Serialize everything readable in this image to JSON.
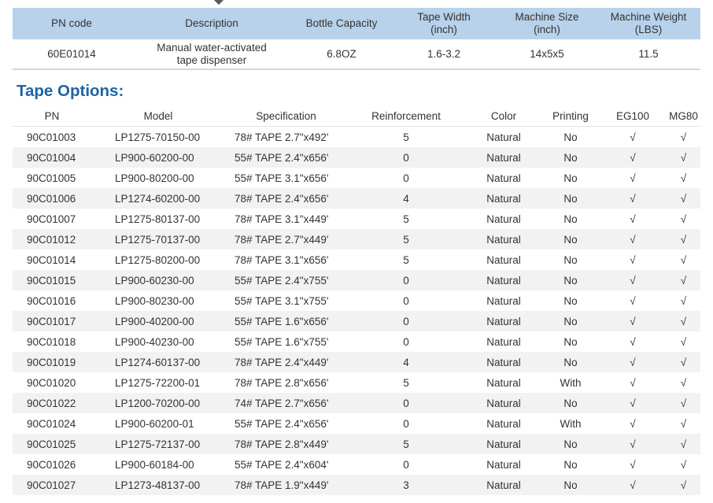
{
  "spec_table": {
    "headers": [
      "PN code",
      "Description",
      "Bottle Capacity",
      "Tape Width\n(inch)",
      "Machine Size\n(inch)",
      "Machine Weight\n(LBS)"
    ],
    "row": [
      "60E01014",
      "Manual water-activated tape dispenser",
      "6.8OZ",
      "1.6-3.2",
      "14x5x5",
      "11.5"
    ]
  },
  "tape_options": {
    "title": "Tape Options:",
    "headers": [
      "PN",
      "Model",
      "Specification",
      "Reinforcement",
      "Color",
      "Printing",
      "EG100",
      "MG80"
    ],
    "rows": [
      [
        "90C01003",
        "LP1275-70150-00",
        "78# TAPE 2.7\"x492'",
        "5",
        "Natural",
        "No",
        "√",
        "√"
      ],
      [
        "90C01004",
        "LP900-60200-00",
        "55# TAPE 2.4\"x656'",
        "0",
        "Natural",
        "No",
        "√",
        "√"
      ],
      [
        "90C01005",
        "LP900-80200-00",
        "55# TAPE 3.1\"x656'",
        "0",
        "Natural",
        "No",
        "√",
        "√"
      ],
      [
        "90C01006",
        "LP1274-60200-00",
        "78# TAPE 2.4\"x656'",
        "4",
        "Natural",
        "No",
        "√",
        "√"
      ],
      [
        "90C01007",
        "LP1275-80137-00",
        "78# TAPE 3.1\"x449'",
        "5",
        "Natural",
        "No",
        "√",
        "√"
      ],
      [
        "90C01012",
        "LP1275-70137-00",
        "78# TAPE 2.7\"x449'",
        "5",
        "Natural",
        "No",
        "√",
        "√"
      ],
      [
        "90C01014",
        "LP1275-80200-00",
        "78# TAPE 3.1\"x656'",
        "5",
        "Natural",
        "No",
        "√",
        "√"
      ],
      [
        "90C01015",
        "LP900-60230-00",
        "55# TAPE 2.4\"x755'",
        "0",
        "Natural",
        "No",
        "√",
        "√"
      ],
      [
        "90C01016",
        "LP900-80230-00",
        "55# TAPE 3.1\"x755'",
        "0",
        "Natural",
        "No",
        "√",
        "√"
      ],
      [
        "90C01017",
        "LP900-40200-00",
        "55# TAPE 1.6\"x656'",
        "0",
        "Natural",
        "No",
        "√",
        "√"
      ],
      [
        "90C01018",
        "LP900-40230-00",
        "55# TAPE 1.6\"x755'",
        "0",
        "Natural",
        "No",
        "√",
        "√"
      ],
      [
        "90C01019",
        "LP1274-60137-00",
        "78# TAPE 2.4\"x449'",
        "4",
        "Natural",
        "No",
        "√",
        "√"
      ],
      [
        "90C01020",
        "LP1275-72200-01",
        "78# TAPE 2.8\"x656'",
        "5",
        "Natural",
        "With",
        "√",
        "√"
      ],
      [
        "90C01022",
        "LP1200-70200-00",
        "74# TAPE 2.7\"x656'",
        "0",
        "Natural",
        "No",
        "√",
        "√"
      ],
      [
        "90C01024",
        "LP900-60200-01",
        "55# TAPE 2.4\"x656'",
        "0",
        "Natural",
        "With",
        "√",
        "√"
      ],
      [
        "90C01025",
        "LP1275-72137-00",
        "78# TAPE 2.8\"x449'",
        "5",
        "Natural",
        "No",
        "√",
        "√"
      ],
      [
        "90C01026",
        "LP900-60184-00",
        "55# TAPE 2.4\"x604'",
        "0",
        "Natural",
        "No",
        "√",
        "√"
      ],
      [
        "90C01027",
        "LP1273-48137-00",
        "78# TAPE 1.9\"x449'",
        "3",
        "Natural",
        "No",
        "√",
        "√"
      ]
    ]
  },
  "colors": {
    "header_band": "#b7d2ea",
    "title_blue": "#1f63a8",
    "stripe": "#f2f2f2"
  }
}
